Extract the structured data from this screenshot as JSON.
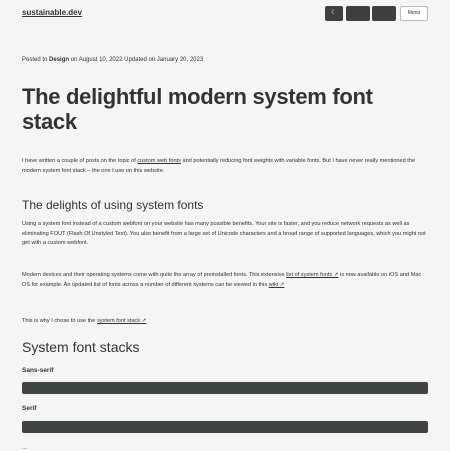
{
  "header": {
    "site_name": "sustainable.dev",
    "buttons": [
      {
        "icon": "moon-icon",
        "glyph": "☾"
      },
      {
        "icon": "font-icon",
        "glyph": ""
      },
      {
        "icon": "text-size-icon",
        "glyph": ""
      }
    ],
    "menu_label": "Menu"
  },
  "meta": {
    "posted_prefix": "Posted to",
    "category": "Design",
    "posted_suffix": "on August 10, 2022",
    "updated": "Updated on January 20, 2023"
  },
  "article": {
    "title": "The delightful modern system font stack",
    "intro": {
      "t1": "I have written a couple of posts on the topic of ",
      "link1": "custom web fonts",
      "t2": " and potentially reducing font weights with variable fonts. But I have never really mentioned the modern system font stack – the one I use on this website."
    },
    "section1": {
      "heading": "The delights of using system fonts",
      "p1": "Using a system font instead of a custom webfont on your website has many possible benefits. Your site is faster, and you reduce network requests as well as eliminating FOUT (Flash Of Unstyled Text). You also benefit from a large set of Unicode characters and a broad range of supported languages, which you might not get with a custom webfont.",
      "p2": {
        "t1": "Modern devices and their operating systems come with quite the array of preinstalled fonts. This extensive ",
        "link1": "list of system fonts ↗",
        "t2": " is now available on iOS and Mac OS for example. An updated list of fonts across a number of different systems can be viewed in this ",
        "link2": "wiki ↗"
      },
      "p3": {
        "t1": "This is why I chose to use the ",
        "link1": "system font stack ↗"
      }
    },
    "section2": {
      "heading": "System font stacks",
      "sub1": "Sans-serif",
      "sub2": "Serif",
      "more": "..."
    }
  }
}
